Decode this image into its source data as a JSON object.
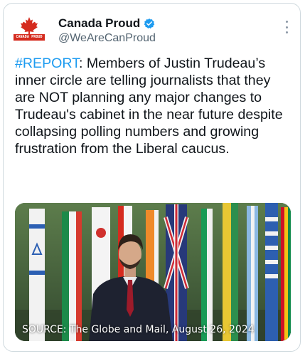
{
  "account": {
    "display_name": "Canada Proud",
    "handle": "@WeAreCanProud",
    "avatar_text": "CANADA PROUD",
    "verified_color": "#1d9bf0"
  },
  "tweet": {
    "hashtag": "#REPORT",
    "body": ": Members of Justin Trudeau’s inner circle are telling journalists that they are NOT planning any major changes to Trudeau's cabinet in the near future despite collapsing polling numbers and growing frustration from the Liberal caucus.",
    "hashtag_color": "#1d9bf0"
  },
  "media": {
    "caption": "SOURCE: The Globe and Mail, August 26, 2024"
  },
  "icons": {
    "more": "more-options-icon",
    "verified": "verified-badge-icon",
    "avatar": "maple-leaf-icon"
  }
}
